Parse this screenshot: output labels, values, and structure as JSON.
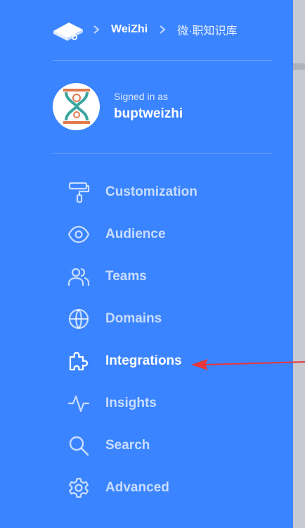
{
  "breadcrumb": {
    "org": "WeiZhi",
    "space": "微·职知识库"
  },
  "user": {
    "signed_in_label": "Signed in as",
    "username": "buptweizhi"
  },
  "nav": {
    "items": [
      {
        "label": "Customization",
        "icon": "paint-roller-icon"
      },
      {
        "label": "Audience",
        "icon": "eye-icon"
      },
      {
        "label": "Teams",
        "icon": "users-icon"
      },
      {
        "label": "Domains",
        "icon": "globe-icon"
      },
      {
        "label": "Integrations",
        "icon": "puzzle-icon",
        "active": true
      },
      {
        "label": "Insights",
        "icon": "activity-icon"
      },
      {
        "label": "Search",
        "icon": "search-icon"
      },
      {
        "label": "Advanced",
        "icon": "gear-icon"
      }
    ]
  },
  "annotation": {
    "color": "#e8363a"
  },
  "colors": {
    "sidebar": "#3b84ff",
    "background": "#c9ccd4"
  }
}
